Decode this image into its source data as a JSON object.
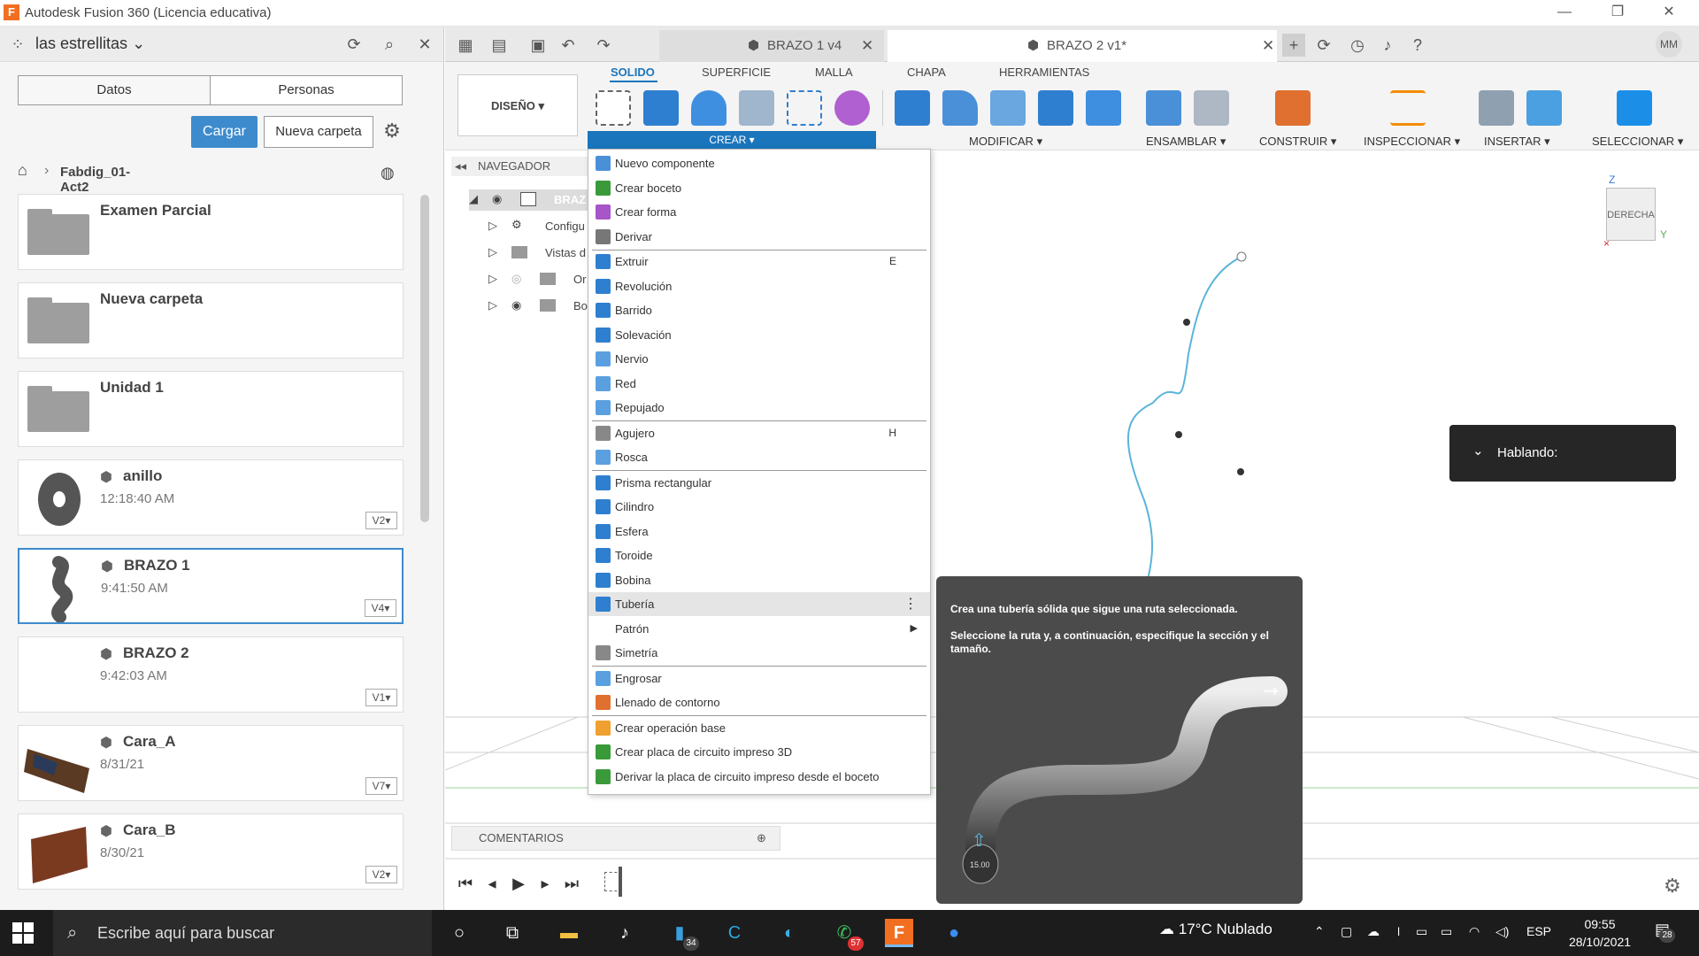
{
  "window": {
    "title": "Autodesk Fusion 360 (Licencia educativa)",
    "logo_letter": "F"
  },
  "data_panel": {
    "team": "las estrellitas",
    "segments": [
      "Datos",
      "Personas"
    ],
    "upload_label": "Cargar",
    "new_folder_label": "Nueva carpeta",
    "breadcrumb": "Fabdig_01-Act2",
    "items": [
      {
        "name": "Examen Parcial",
        "type": "folder",
        "time": "",
        "version": ""
      },
      {
        "name": "Nueva carpeta",
        "type": "folder",
        "time": "",
        "version": ""
      },
      {
        "name": "Unidad 1",
        "type": "folder",
        "time": "",
        "version": ""
      },
      {
        "name": "anillo",
        "type": "design",
        "time": "12:18:40 AM",
        "version": "V2"
      },
      {
        "name": "BRAZO 1",
        "type": "design",
        "time": "9:41:50 AM",
        "version": "V4"
      },
      {
        "name": "BRAZO 2",
        "type": "design",
        "time": "9:42:03 AM",
        "version": "V1"
      },
      {
        "name": "Cara_A",
        "type": "design",
        "time": "8/31/21",
        "version": "V7"
      },
      {
        "name": "Cara_B",
        "type": "design",
        "time": "8/30/21",
        "version": "V2"
      }
    ]
  },
  "tabs": [
    {
      "label": "BRAZO 1 v4"
    },
    {
      "label": "BRAZO 2 v1*"
    }
  ],
  "user_initials": "MM",
  "toolbar": {
    "workspace": "DISEÑO",
    "ribbon_tabs": [
      "SOLIDO",
      "SUPERFICIE",
      "MALLA",
      "CHAPA",
      "HERRAMIENTAS"
    ],
    "groups": [
      "CREAR",
      "MODIFICAR",
      "ENSAMBLAR",
      "CONSTRUIR",
      "INSPECCIONAR",
      "INSERTAR",
      "SELECCIONAR"
    ]
  },
  "navigator": {
    "title": "NAVEGADOR",
    "rows": [
      "BRAZ",
      "Configu",
      "Vistas d",
      "Or",
      "Bo"
    ]
  },
  "crear_menu": {
    "items": [
      {
        "label": "Nuevo componente",
        "shortcut": "",
        "icon_color": "#4a90d9"
      },
      {
        "label": "Crear boceto",
        "shortcut": "",
        "icon_color": "#3a9a3a"
      },
      {
        "label": "Crear forma",
        "shortcut": "",
        "icon_color": "#a855c8"
      },
      {
        "label": "Derivar",
        "shortcut": "",
        "icon_color": "#777777"
      },
      {
        "label": "Extruir",
        "shortcut": "E",
        "icon_color": "#2f7fd0"
      },
      {
        "label": "Revolución",
        "shortcut": "",
        "icon_color": "#2f7fd0"
      },
      {
        "label": "Barrido",
        "shortcut": "",
        "icon_color": "#2f7fd0"
      },
      {
        "label": "Solevación",
        "shortcut": "",
        "icon_color": "#2f7fd0"
      },
      {
        "label": "Nervio",
        "shortcut": "",
        "icon_color": "#5aa0e0"
      },
      {
        "label": "Red",
        "shortcut": "",
        "icon_color": "#5aa0e0"
      },
      {
        "label": "Repujado",
        "shortcut": "",
        "icon_color": "#5aa0e0"
      },
      {
        "label": "Agujero",
        "shortcut": "H",
        "icon_color": "#888888"
      },
      {
        "label": "Rosca",
        "shortcut": "",
        "icon_color": "#5aa0e0"
      },
      {
        "label": "Prisma rectangular",
        "shortcut": "",
        "icon_color": "#2f7fd0"
      },
      {
        "label": "Cilindro",
        "shortcut": "",
        "icon_color": "#2f7fd0"
      },
      {
        "label": "Esfera",
        "shortcut": "",
        "icon_color": "#2f7fd0"
      },
      {
        "label": "Toroide",
        "shortcut": "",
        "icon_color": "#2f7fd0"
      },
      {
        "label": "Bobina",
        "shortcut": "",
        "icon_color": "#2f7fd0"
      },
      {
        "label": "Tubería",
        "shortcut": "",
        "icon_color": "#2f7fd0"
      },
      {
        "label": "Patrón",
        "shortcut": "",
        "icon_color": ""
      },
      {
        "label": "Simetría",
        "shortcut": "",
        "icon_color": "#888888"
      },
      {
        "label": "Engrosar",
        "shortcut": "",
        "icon_color": "#5aa0e0"
      },
      {
        "label": "Llenado de contorno",
        "shortcut": "",
        "icon_color": "#e07030"
      },
      {
        "label": "Crear operación base",
        "shortcut": "",
        "icon_color": "#f0a030"
      },
      {
        "label": "Crear placa de circuito impreso 3D",
        "shortcut": "",
        "icon_color": "#3a9a3a"
      },
      {
        "label": "Derivar la placa de circuito impreso desde el boceto",
        "shortcut": "",
        "icon_color": "#3a9a3a"
      }
    ]
  },
  "tooltip": {
    "title": "Crea una tubería sólida que sigue una ruta seleccionada.",
    "body": "Seleccione la ruta y, a continuación, especifique la sección y el tamaño.",
    "value_label": "15.00"
  },
  "hablando_label": "Hablando:",
  "viewcube": {
    "face": "DERECHA",
    "z_label": "Z",
    "y_label": "Y"
  },
  "comments_label": "COMENTARIOS",
  "taskbar": {
    "search_placeholder": "Escribe aquí para buscar",
    "badge_34": "34",
    "badge_57": "57",
    "weather": "17°C  Nublado",
    "lang": "ESP",
    "time": "09:55",
    "date": "28/10/2021",
    "notif_count": "28"
  },
  "colors": {
    "accent": "#1b75bc",
    "upload_button": "#3d8bcd",
    "sketch_path": "#5bb4dc"
  }
}
